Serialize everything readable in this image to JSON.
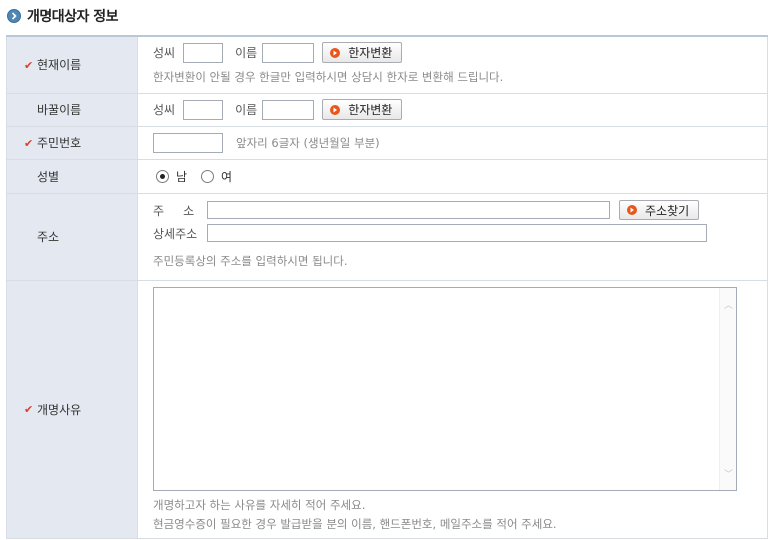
{
  "section_title": "개명대상자 정보",
  "rows": {
    "current_name": {
      "label": "현재이름",
      "surname_label": "성씨",
      "name_label": "이름",
      "hanja_button": "한자변환",
      "help": "한자변환이 안될 경우 한글만 입력하시면 상담시 한자로 변환해 드립니다."
    },
    "new_name": {
      "label": "바꿀이름",
      "surname_label": "성씨",
      "name_label": "이름",
      "hanja_button": "한자변환"
    },
    "resident_number": {
      "label": "주민번호",
      "help": "앞자리 6글자 (생년월일 부분)"
    },
    "gender": {
      "label": "성별",
      "options": [
        "남",
        "여"
      ],
      "selected": "남"
    },
    "address": {
      "label": "주소",
      "address_label": "주     소",
      "detail_label": "상세주소",
      "search_button": "주소찾기",
      "help": "주민등록상의 주소를 입력하시면 됩니다."
    },
    "reason": {
      "label": "개명사유",
      "help1": "개명하고자 하는 사유를 자세히 적어 주세요.",
      "help2": "현금영수증이 필요한 경우 발급받을 분의 이름, 핸드폰번호, 메일주소를 적어 주세요."
    }
  },
  "colors": {
    "label_bg": "#e4e9f1",
    "check": "#d9412e",
    "button_dot": "#e8561c",
    "title_icon": "#4f86b3"
  }
}
